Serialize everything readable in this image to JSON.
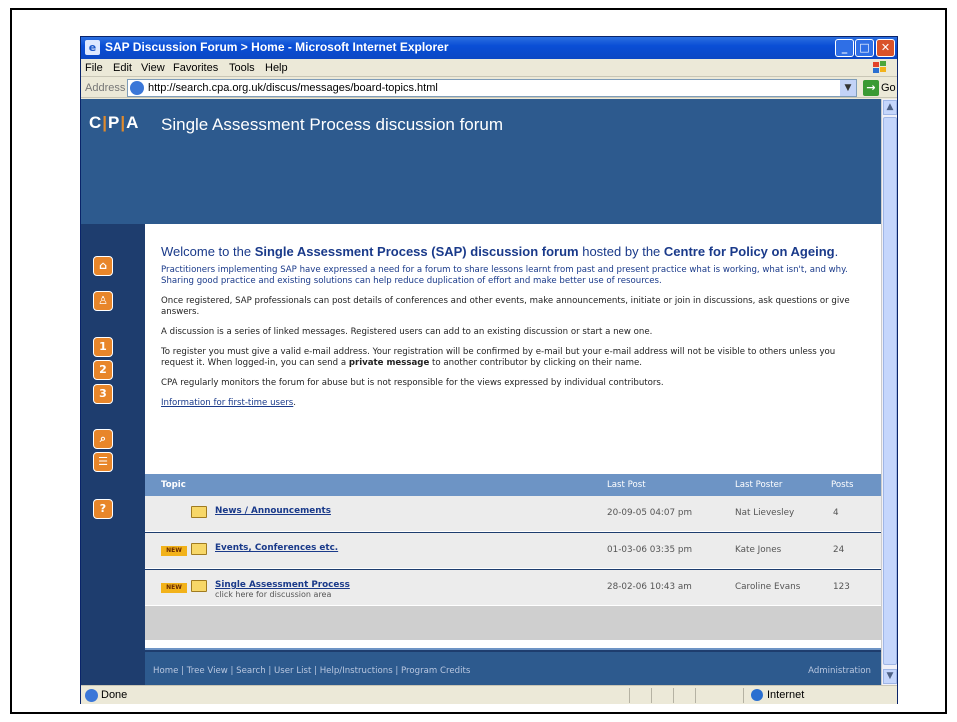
{
  "window": {
    "title": "SAP Discussion Forum > Home - Microsoft Internet Explorer"
  },
  "menu": [
    "File",
    "Edit",
    "View",
    "Favorites",
    "Tools",
    "Help"
  ],
  "address": {
    "label": "Address",
    "url": "http://search.cpa.org.uk/discus/messages/board-topics.html",
    "go": "Go"
  },
  "site": {
    "logo_c": "C",
    "logo_p": "P",
    "logo_a": "A",
    "title": "Single Assessment Process discussion forum"
  },
  "content": {
    "welcome_prefix": "Welcome to the ",
    "welcome_bold1": "Single Assessment Process (SAP) discussion forum",
    "welcome_mid": " hosted by the ",
    "welcome_bold2": "Centre for Policy on Ageing",
    "welcome_end": ".",
    "p1": "Practitioners implementing SAP have expressed a need for a forum to share lessons learnt from past and present practice what is working, what isn't, and why. Sharing good practice and existing solutions can help reduce duplication of effort and make better use of resources.",
    "p2": "Once registered, SAP professionals can post details of conferences and other events, make announcements, initiate or join in discussions, ask questions or give answers.",
    "p3": "A discussion is a series of linked messages. Registered users can add to an existing discussion or start a new one.",
    "p4_a": "To register you must give a valid e-mail address. Your registration will be confirmed by e-mail but your e-mail address will not be visible to others unless you request it. When logged-in, you can send a ",
    "p4_bold": "private message",
    "p4_b": " to another contributor by clicking on their name.",
    "p5": "CPA regularly monitors the forum for abuse but is not responsible for the views expressed by individual contributors.",
    "info_link": "Information for first-time users",
    "info_end": "."
  },
  "table": {
    "headers": {
      "topic": "Topic",
      "last_post": "Last Post",
      "last_poster": "Last Poster",
      "posts": "Posts"
    },
    "rows": [
      {
        "new": "",
        "title": "News / Announcements",
        "sub": "",
        "last_post": "20-09-05 04:07 pm",
        "last_poster": "Nat Lievesley",
        "posts": "4"
      },
      {
        "new": "NEW",
        "title": "Events, Conferences etc.",
        "sub": "",
        "last_post": "01-03-06 03:35 pm",
        "last_poster": "Kate Jones",
        "posts": "24"
      },
      {
        "new": "NEW",
        "title": "Single Assessment Process",
        "sub": "click here for discussion area",
        "last_post": "28-02-06 10:43 am",
        "last_poster": "Caroline Evans",
        "posts": "123"
      }
    ]
  },
  "footer": {
    "links": "Home | Tree View | Search | User List | Help/Instructions | Program Credits",
    "admin": "Administration"
  },
  "status": {
    "text": "Done",
    "zone": "Internet"
  },
  "colors": {
    "header_blue": "#2d5a8e",
    "sidebar_navy": "#1e3d6e",
    "accent_orange": "#e8862a",
    "link_blue": "#1a3a8a"
  }
}
